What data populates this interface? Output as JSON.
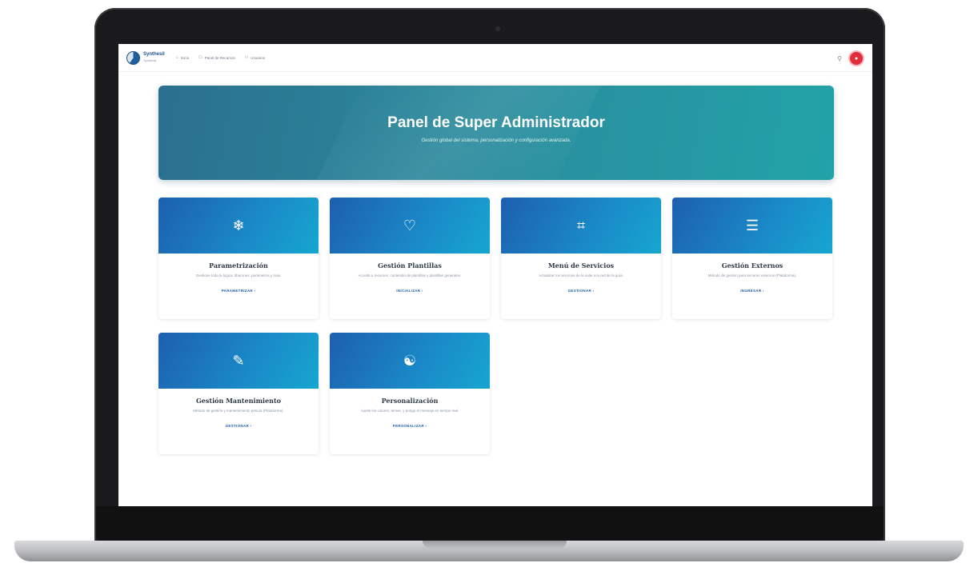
{
  "app": {
    "brand_name": "Synthesil",
    "brand_sub": "Synthesil"
  },
  "nav": {
    "items": [
      {
        "icon": "⌂",
        "label": "Inicio"
      },
      {
        "icon": "☐",
        "label": "Panel de Recursos"
      },
      {
        "icon": "⚇",
        "label": "Usuarios"
      }
    ]
  },
  "hero": {
    "title": "Panel de Super Administrador",
    "subtitle": "Gestión global del sistema, personalización y configuración avanzada."
  },
  "cards": [
    {
      "icon": "snowflake-icon",
      "glyph": "❄",
      "title": "Parametrización",
      "desc": "Gestione toda la lógica, tiburones, parámetros y más.",
      "link": "PARAMETRIZAR ›"
    },
    {
      "icon": "heart-icon",
      "glyph": "♡",
      "title": "Gestión Plantillas",
      "desc": "Acceda a recursos, contenido de plantillas y plantillas generales.",
      "link": "INICIALIZAR ›"
    },
    {
      "icon": "ticket-icon",
      "glyph": "⌗",
      "title": "Menú de Servicios",
      "desc": "Actualizar los servicios de la suite a la red de la guía.",
      "link": "GESTIONAR ›"
    },
    {
      "icon": "list-icon",
      "glyph": "☰",
      "title": "Gestión Externos",
      "desc": "Método de gestión para terceros externos (Plataforma).",
      "link": "INGRESAR ›"
    },
    {
      "icon": "pen-icon",
      "glyph": "✎",
      "title": "Gestión Mantenimiento",
      "desc": "Método de gestión y mantenimiento para la (Plataforma).",
      "link": "GESTIONAR ›"
    },
    {
      "icon": "support-icon",
      "glyph": "☯",
      "title": "Personalización",
      "desc": "Ajuste los colores, temas, y ponga el mensaje en tiempo real.",
      "link": "PERSONALIZAR ›"
    }
  ],
  "colors": {
    "hero_start": "#2b6f8f",
    "hero_end": "#22a3a8",
    "card_header": "#1a8bc8",
    "link": "#1f5fa8",
    "avatar": "#e02d3c"
  }
}
